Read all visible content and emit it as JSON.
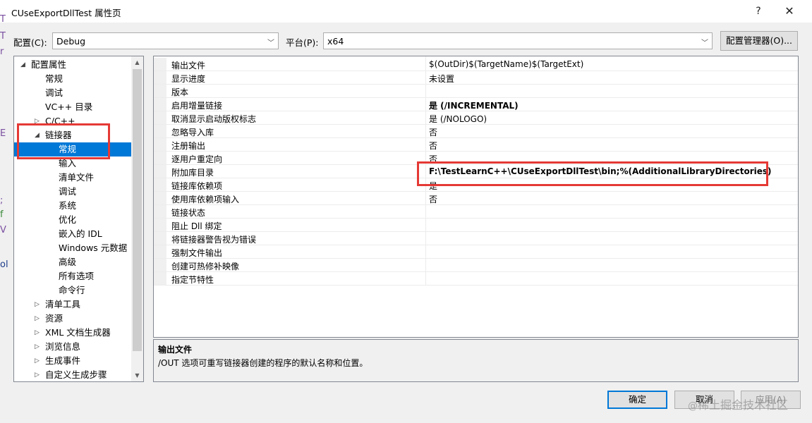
{
  "window": {
    "title": "CUseExportDllTest 属性页",
    "help": "?",
    "close": "✕"
  },
  "config": {
    "config_label": "配置(C):",
    "config_value": "Debug",
    "platform_label": "平台(P):",
    "platform_value": "x64",
    "manager_button": "配置管理器(O)..."
  },
  "tree": [
    {
      "label": "配置属性",
      "level": 0,
      "toggle": "◢"
    },
    {
      "label": "常规",
      "level": 1
    },
    {
      "label": "调试",
      "level": 1
    },
    {
      "label": "VC++ 目录",
      "level": 1
    },
    {
      "label": "C/C++",
      "level": 1,
      "toggle": "▷"
    },
    {
      "label": "链接器",
      "level": 1,
      "toggle": "◢"
    },
    {
      "label": "常规",
      "level": 2,
      "selected": true
    },
    {
      "label": "输入",
      "level": 2
    },
    {
      "label": "清单文件",
      "level": 2
    },
    {
      "label": "调试",
      "level": 2
    },
    {
      "label": "系统",
      "level": 2
    },
    {
      "label": "优化",
      "level": 2
    },
    {
      "label": "嵌入的 IDL",
      "level": 2
    },
    {
      "label": "Windows 元数据",
      "level": 2
    },
    {
      "label": "高级",
      "level": 2
    },
    {
      "label": "所有选项",
      "level": 2
    },
    {
      "label": "命令行",
      "level": 2
    },
    {
      "label": "清单工具",
      "level": 1,
      "toggle": "▷"
    },
    {
      "label": "资源",
      "level": 1,
      "toggle": "▷"
    },
    {
      "label": "XML 文档生成器",
      "level": 1,
      "toggle": "▷"
    },
    {
      "label": "浏览信息",
      "level": 1,
      "toggle": "▷"
    },
    {
      "label": "生成事件",
      "level": 1,
      "toggle": "▷"
    },
    {
      "label": "自定义生成步骤",
      "level": 1,
      "toggle": "▷"
    }
  ],
  "properties": [
    {
      "name": "输出文件",
      "value": "$(OutDir)$(TargetName)$(TargetExt)"
    },
    {
      "name": "显示进度",
      "value": "未设置"
    },
    {
      "name": "版本",
      "value": ""
    },
    {
      "name": "启用增量链接",
      "value": "是 (/INCREMENTAL)",
      "bold": true
    },
    {
      "name": "取消显示启动版权标志",
      "value": "是 (/NOLOGO)"
    },
    {
      "name": "忽略导入库",
      "value": "否"
    },
    {
      "name": "注册输出",
      "value": "否"
    },
    {
      "name": "逐用户重定向",
      "value": "否"
    },
    {
      "name": "附加库目录",
      "value": "F:\\TestLearnC++\\CUseExportDllTest\\bin;%(AdditionalLibraryDirectories)",
      "bold": true
    },
    {
      "name": "链接库依赖项",
      "value": "是"
    },
    {
      "name": "使用库依赖项输入",
      "value": "否"
    },
    {
      "name": "链接状态",
      "value": ""
    },
    {
      "name": "阻止 Dll 绑定",
      "value": ""
    },
    {
      "name": "将链接器警告视为错误",
      "value": ""
    },
    {
      "name": "强制文件输出",
      "value": ""
    },
    {
      "name": "创建可热修补映像",
      "value": ""
    },
    {
      "name": "指定节特性",
      "value": ""
    }
  ],
  "description": {
    "title": "输出文件",
    "text": "/OUT 选项可重写链接器创建的程序的默认名称和位置。"
  },
  "buttons": {
    "ok": "确定",
    "cancel": "取消",
    "apply": "应用(A)"
  },
  "watermark": {
    "at": "@",
    "text": "稀土掘金技术社区"
  },
  "edge_glyphs": [
    "T",
    "T",
    "r",
    "E",
    ";",
    "f",
    "V",
    "ol"
  ],
  "colors": {
    "selection": "#0078d7",
    "annotation": "#e53935"
  }
}
